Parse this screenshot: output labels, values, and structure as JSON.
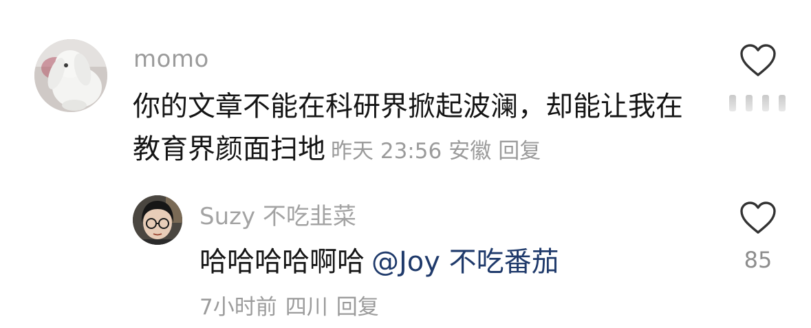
{
  "comment": {
    "username": "momo",
    "text": "你的文章不能在科研界掀起波澜，却能让我在教育界颜面扫地",
    "time": "昨天 23:56",
    "location": "安徽",
    "reply_label": "回复",
    "avatar_icon": "bunny-avatar-icon",
    "like_icon": "heart-outline-icon"
  },
  "reply": {
    "username": "Suzy 不吃韭菜",
    "text": "哈哈哈哈啊哈",
    "mention": "@Joy 不吃番茄",
    "time": "7小时前",
    "location": "四川",
    "reply_label": "回复",
    "like_count": "85",
    "avatar_icon": "person-glasses-avatar-icon",
    "like_icon": "heart-outline-icon"
  },
  "colors": {
    "text_primary": "#151515",
    "text_secondary": "#9b9b9b",
    "mention": "#1f3a6b"
  }
}
